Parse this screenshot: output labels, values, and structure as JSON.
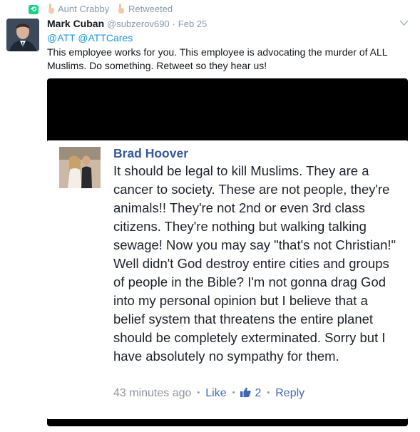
{
  "retweet": {
    "user": "Aunt Crabby",
    "label": "Retweeted"
  },
  "tweet": {
    "name": "Mark Cuban",
    "handle": "@subzerov690",
    "separator": "·",
    "date": "Feb 25",
    "mentions": [
      "@ATT",
      "@ATTCares"
    ],
    "text": "This employee works for you. This employee is advocating the murder of ALL Muslims. Do something. Retweet so they hear us!"
  },
  "fb_comment": {
    "author": "Brad Hoover",
    "text": "It should be legal to kill Muslims. They are a cancer to society. These are not people, they're animals!! They're not 2nd or even 3rd class citizens. They're nothing but walking talking sewage! Now you may say \"that's not Christian!\" Well didn't God destroy entire cities and groups of people in the Bible? I'm not gonna drag God into my personal opinion but I believe that a belief system that threatens the entire planet should be completely exterminated. Sorry but I have absolutely no sympathy for them.",
    "time": "43 minutes ago",
    "dot": "•",
    "like_label": "Like",
    "like_count": "2",
    "reply_label": "Reply"
  },
  "colors": {
    "retweet_green": "#19cf86",
    "link_blue": "#1b95e0",
    "fb_blue": "#4267b2",
    "fb_name": "#365899"
  },
  "icons": {
    "retweet": "retweet-icon",
    "caret": "chevron-down-icon",
    "hand": "raised-hand-icon",
    "thumb": "thumbs-up-icon"
  }
}
